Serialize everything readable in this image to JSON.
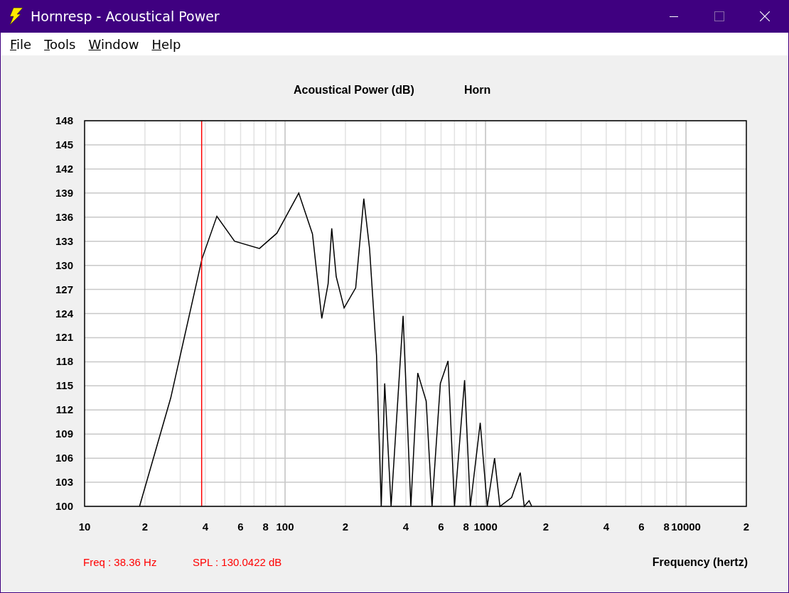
{
  "window": {
    "title": "Hornresp - Acoustical Power"
  },
  "menu": [
    {
      "label": "File"
    },
    {
      "label": "Tools"
    },
    {
      "label": "Window"
    },
    {
      "label": "Help"
    }
  ],
  "chart": {
    "title": "Acoustical Power (dB)",
    "subtitle": "Horn",
    "xlabel": "Frequency (hertz)",
    "y_tick_labels": [
      "148",
      "145",
      "142",
      "139",
      "136",
      "133",
      "130",
      "127",
      "124",
      "121",
      "118",
      "115",
      "112",
      "109",
      "106",
      "103",
      "100"
    ],
    "x_tick_labels": [
      "10",
      "2",
      "4",
      "6",
      "8",
      "100",
      "2",
      "4",
      "6",
      "8",
      "1000",
      "2",
      "4",
      "6",
      "8",
      "10000",
      "2"
    ],
    "readout": {
      "freq": "Freq : 38.36 Hz",
      "spl": "SPL : 130.0422 dB"
    }
  }
}
